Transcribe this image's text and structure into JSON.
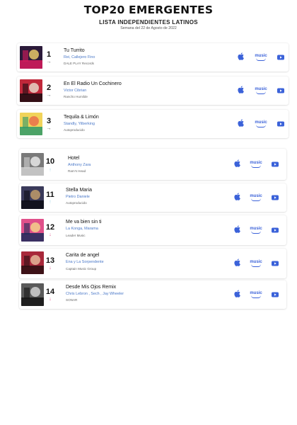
{
  "header": {
    "title": "TOP20 EMERGENTES",
    "subtitle": "LISTA INDEPENDIENTES LATINOS",
    "date": "Semana del 22 de Agosto de 2022"
  },
  "colors": {
    "accent": "#3b62d9",
    "artist": "#4a78c8",
    "down": "#e0508a",
    "new": "#9fd8e8"
  },
  "services": [
    {
      "icon": "apple-music-icon",
      "label": ""
    },
    {
      "icon": "amazon-music-icon",
      "label": "music"
    },
    {
      "icon": "youtube-icon",
      "label": ""
    }
  ],
  "entries": [
    {
      "rank": "1",
      "trend": "→",
      "trend_type": "same",
      "title": "Tu Turrito",
      "artist": "Rei, Callejero Fino",
      "label": "DALE PLAY Records",
      "cover": [
        "#d81b5e",
        "#2b1a3a",
        "#f2d36b"
      ]
    },
    {
      "rank": "2",
      "trend": "→",
      "trend_type": "same",
      "title": "En El Radio Un Cochinero",
      "artist": "Victor Cibrian",
      "label": "Rancho Humilde",
      "cover": [
        "#1a0a10",
        "#c0283a",
        "#e8e0d0"
      ]
    },
    {
      "rank": "3",
      "trend": "→",
      "trend_type": "same",
      "title": "Tequila & Limón",
      "artist": "Standly, Yilberking",
      "label": "Autoproducido",
      "cover": [
        "#2f9a6a",
        "#f1d35a",
        "#e86a4a"
      ]
    },
    {
      "rank": "10",
      "trend": "↑",
      "trend_type": "new",
      "title": "Hotel",
      "artist": "Anthony Zara",
      "label": "Ram's Head",
      "cover": [
        "#cfcfcf",
        "#7a7a7a",
        "#efefef"
      ]
    },
    {
      "rank": "11",
      "trend": "↑",
      "trend_type": "new",
      "title": "Stella Maria",
      "artist": "Pietro Daniele",
      "label": "Autoproducido",
      "cover": [
        "#0c0c14",
        "#3a3a5a",
        "#c9a26b"
      ]
    },
    {
      "rank": "12",
      "trend": "↓",
      "trend_type": "down",
      "title": "Me va bien sin ti",
      "artist": "La Konga, Marama",
      "label": "Leader Music",
      "cover": [
        "#1c2a5a",
        "#e0508a",
        "#f5d98a"
      ]
    },
    {
      "rank": "13",
      "trend": "↓",
      "trend_type": "down",
      "title": "Carita de angel",
      "artist": "Ena y La Sorpendente",
      "label": "Captain Music Group",
      "cover": [
        "#2a0e12",
        "#a8283a",
        "#e8c0a0"
      ]
    },
    {
      "rank": "14",
      "trend": "↓",
      "trend_type": "down",
      "title": "Desde Mis Ojos Remix",
      "artist": "Chris Lebron , Sech , Jay Wheeler",
      "label": "SONAR",
      "cover": [
        "#141414",
        "#5a5a5a",
        "#d8d8d8"
      ]
    }
  ]
}
